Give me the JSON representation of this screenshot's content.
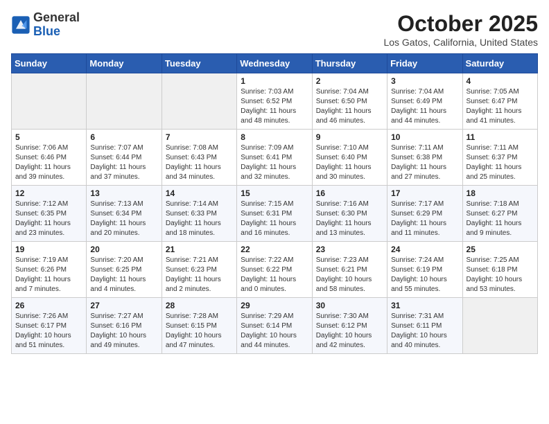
{
  "header": {
    "logo_general": "General",
    "logo_blue": "Blue",
    "month_title": "October 2025",
    "location": "Los Gatos, California, United States"
  },
  "weekdays": [
    "Sunday",
    "Monday",
    "Tuesday",
    "Wednesday",
    "Thursday",
    "Friday",
    "Saturday"
  ],
  "weeks": [
    [
      {
        "day": "",
        "detail": ""
      },
      {
        "day": "",
        "detail": ""
      },
      {
        "day": "",
        "detail": ""
      },
      {
        "day": "1",
        "detail": "Sunrise: 7:03 AM\nSunset: 6:52 PM\nDaylight: 11 hours\nand 48 minutes."
      },
      {
        "day": "2",
        "detail": "Sunrise: 7:04 AM\nSunset: 6:50 PM\nDaylight: 11 hours\nand 46 minutes."
      },
      {
        "day": "3",
        "detail": "Sunrise: 7:04 AM\nSunset: 6:49 PM\nDaylight: 11 hours\nand 44 minutes."
      },
      {
        "day": "4",
        "detail": "Sunrise: 7:05 AM\nSunset: 6:47 PM\nDaylight: 11 hours\nand 41 minutes."
      }
    ],
    [
      {
        "day": "5",
        "detail": "Sunrise: 7:06 AM\nSunset: 6:46 PM\nDaylight: 11 hours\nand 39 minutes."
      },
      {
        "day": "6",
        "detail": "Sunrise: 7:07 AM\nSunset: 6:44 PM\nDaylight: 11 hours\nand 37 minutes."
      },
      {
        "day": "7",
        "detail": "Sunrise: 7:08 AM\nSunset: 6:43 PM\nDaylight: 11 hours\nand 34 minutes."
      },
      {
        "day": "8",
        "detail": "Sunrise: 7:09 AM\nSunset: 6:41 PM\nDaylight: 11 hours\nand 32 minutes."
      },
      {
        "day": "9",
        "detail": "Sunrise: 7:10 AM\nSunset: 6:40 PM\nDaylight: 11 hours\nand 30 minutes."
      },
      {
        "day": "10",
        "detail": "Sunrise: 7:11 AM\nSunset: 6:38 PM\nDaylight: 11 hours\nand 27 minutes."
      },
      {
        "day": "11",
        "detail": "Sunrise: 7:11 AM\nSunset: 6:37 PM\nDaylight: 11 hours\nand 25 minutes."
      }
    ],
    [
      {
        "day": "12",
        "detail": "Sunrise: 7:12 AM\nSunset: 6:35 PM\nDaylight: 11 hours\nand 23 minutes."
      },
      {
        "day": "13",
        "detail": "Sunrise: 7:13 AM\nSunset: 6:34 PM\nDaylight: 11 hours\nand 20 minutes."
      },
      {
        "day": "14",
        "detail": "Sunrise: 7:14 AM\nSunset: 6:33 PM\nDaylight: 11 hours\nand 18 minutes."
      },
      {
        "day": "15",
        "detail": "Sunrise: 7:15 AM\nSunset: 6:31 PM\nDaylight: 11 hours\nand 16 minutes."
      },
      {
        "day": "16",
        "detail": "Sunrise: 7:16 AM\nSunset: 6:30 PM\nDaylight: 11 hours\nand 13 minutes."
      },
      {
        "day": "17",
        "detail": "Sunrise: 7:17 AM\nSunset: 6:29 PM\nDaylight: 11 hours\nand 11 minutes."
      },
      {
        "day": "18",
        "detail": "Sunrise: 7:18 AM\nSunset: 6:27 PM\nDaylight: 11 hours\nand 9 minutes."
      }
    ],
    [
      {
        "day": "19",
        "detail": "Sunrise: 7:19 AM\nSunset: 6:26 PM\nDaylight: 11 hours\nand 7 minutes."
      },
      {
        "day": "20",
        "detail": "Sunrise: 7:20 AM\nSunset: 6:25 PM\nDaylight: 11 hours\nand 4 minutes."
      },
      {
        "day": "21",
        "detail": "Sunrise: 7:21 AM\nSunset: 6:23 PM\nDaylight: 11 hours\nand 2 minutes."
      },
      {
        "day": "22",
        "detail": "Sunrise: 7:22 AM\nSunset: 6:22 PM\nDaylight: 11 hours\nand 0 minutes."
      },
      {
        "day": "23",
        "detail": "Sunrise: 7:23 AM\nSunset: 6:21 PM\nDaylight: 10 hours\nand 58 minutes."
      },
      {
        "day": "24",
        "detail": "Sunrise: 7:24 AM\nSunset: 6:19 PM\nDaylight: 10 hours\nand 55 minutes."
      },
      {
        "day": "25",
        "detail": "Sunrise: 7:25 AM\nSunset: 6:18 PM\nDaylight: 10 hours\nand 53 minutes."
      }
    ],
    [
      {
        "day": "26",
        "detail": "Sunrise: 7:26 AM\nSunset: 6:17 PM\nDaylight: 10 hours\nand 51 minutes."
      },
      {
        "day": "27",
        "detail": "Sunrise: 7:27 AM\nSunset: 6:16 PM\nDaylight: 10 hours\nand 49 minutes."
      },
      {
        "day": "28",
        "detail": "Sunrise: 7:28 AM\nSunset: 6:15 PM\nDaylight: 10 hours\nand 47 minutes."
      },
      {
        "day": "29",
        "detail": "Sunrise: 7:29 AM\nSunset: 6:14 PM\nDaylight: 10 hours\nand 44 minutes."
      },
      {
        "day": "30",
        "detail": "Sunrise: 7:30 AM\nSunset: 6:12 PM\nDaylight: 10 hours\nand 42 minutes."
      },
      {
        "day": "31",
        "detail": "Sunrise: 7:31 AM\nSunset: 6:11 PM\nDaylight: 10 hours\nand 40 minutes."
      },
      {
        "day": "",
        "detail": ""
      }
    ]
  ]
}
